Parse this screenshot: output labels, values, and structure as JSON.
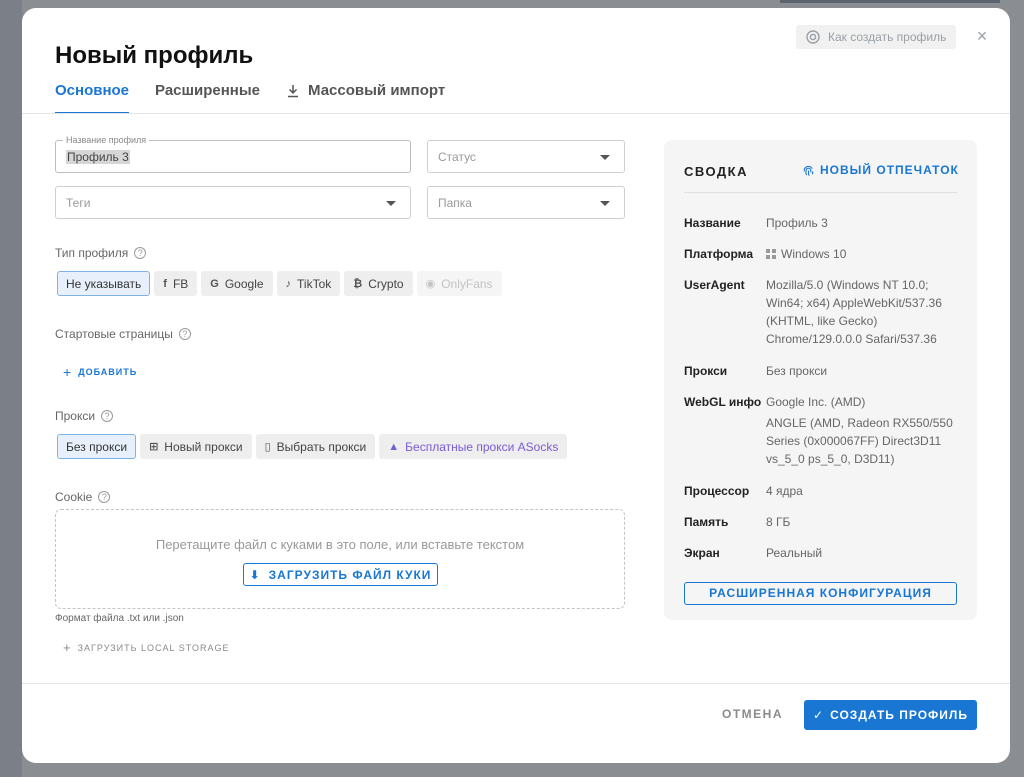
{
  "modal": {
    "title": "Новый профиль",
    "howto_label": "Как создать профиль",
    "close_glyph": "×"
  },
  "tabs": [
    {
      "label": "Основное",
      "active": true
    },
    {
      "label": "Расширенные",
      "active": false
    },
    {
      "label": "Массовый импорт",
      "active": false,
      "icon": "download-icon"
    }
  ],
  "form": {
    "name": {
      "label": "Название профиля",
      "value": "Профиль 3"
    },
    "status": {
      "placeholder": "Статус"
    },
    "tags": {
      "placeholder": "Теги"
    },
    "folder": {
      "placeholder": "Папка"
    },
    "profile_type": {
      "label": "Тип профиля",
      "options": [
        {
          "label": "Не указывать",
          "icon": "",
          "state": "selected"
        },
        {
          "label": "FB",
          "icon": "facebook-icon",
          "glyph": "f",
          "state": "normal"
        },
        {
          "label": "Google",
          "icon": "google-icon",
          "glyph": "G",
          "state": "normal"
        },
        {
          "label": "TikTok",
          "icon": "tiktok-icon",
          "glyph": "♪",
          "state": "normal"
        },
        {
          "label": "Crypto",
          "icon": "bitcoin-icon",
          "glyph": "₿",
          "state": "normal"
        },
        {
          "label": "OnlyFans",
          "icon": "onlyfans-icon",
          "glyph": "◉",
          "state": "disabled"
        }
      ]
    },
    "start_pages": {
      "label": "Стартовые страницы",
      "add_label": "ДОБАВИТЬ"
    },
    "proxy": {
      "label": "Прокси",
      "options": [
        {
          "label": "Без прокси",
          "icon": "",
          "state": "selected"
        },
        {
          "label": "Новый прокси",
          "icon": "add-box-icon",
          "glyph": "⊞",
          "state": "normal"
        },
        {
          "label": "Выбрать прокси",
          "icon": "bookmark-icon",
          "glyph": "▯",
          "state": "normal"
        },
        {
          "label": "Бесплатные прокси ASocks",
          "icon": "asocks-icon",
          "glyph": "▲",
          "state": "purple"
        }
      ]
    },
    "cookie": {
      "label": "Cookie",
      "drop_text": "Перетащите файл с куками в это поле, или вставьте текстом",
      "upload_label": "ЗАГРУЗИТЬ ФАЙЛ КУКИ",
      "format_hint": "Формат файла .txt или .json",
      "local_storage_label": "ЗАГРУЗИТЬ LOCAL STORAGE"
    }
  },
  "summary": {
    "title": "СВОДКА",
    "fingerprint_label": "НОВЫЙ ОТПЕЧАТОК",
    "rows": [
      {
        "key": "Название",
        "value": "Профиль 3"
      },
      {
        "key": "Платформа",
        "value": "Windows 10",
        "icon": "windows-icon"
      },
      {
        "key": "UserAgent",
        "value": "Mozilla/5.0 (Windows NT 10.0; Win64; x64) AppleWebKit/537.36 (KHTML, like Gecko) Chrome/129.0.0.0 Safari/537.36"
      },
      {
        "key": "Прокси",
        "value": "Без прокси"
      },
      {
        "key": "WebGL инфо",
        "value": "Google Inc. (AMD)",
        "value2": "ANGLE (AMD, Radeon RX550/550 Series (0x000067FF) Direct3D11 vs_5_0 ps_5_0, D3D11)"
      },
      {
        "key": "Процессор",
        "value": "4 ядра"
      },
      {
        "key": "Память",
        "value": "8 ГБ"
      },
      {
        "key": "Экран",
        "value": "Реальный"
      }
    ],
    "advanced_label": "РАСШИРЕННАЯ КОНФИГУРАЦИЯ"
  },
  "footer": {
    "cancel_label": "ОТМЕНА",
    "create_label": "СОЗДАТЬ ПРОФИЛЬ"
  },
  "colors": {
    "accent": "#1976d2",
    "purple": "#7a5bd6"
  }
}
